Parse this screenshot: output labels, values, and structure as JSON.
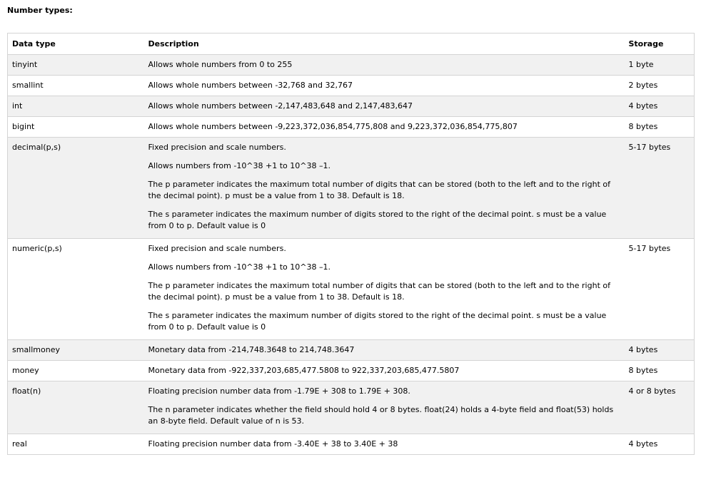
{
  "heading": "Number types:",
  "table": {
    "headers": [
      "Data type",
      "Description",
      "Storage"
    ],
    "rows": [
      {
        "type": "tinyint",
        "description": [
          "Allows whole numbers from 0 to 255"
        ],
        "storage": "1 byte"
      },
      {
        "type": "smallint",
        "description": [
          "Allows whole numbers between -32,768 and 32,767"
        ],
        "storage": "2 bytes"
      },
      {
        "type": "int",
        "description": [
          "Allows whole numbers between -2,147,483,648 and 2,147,483,647"
        ],
        "storage": "4 bytes"
      },
      {
        "type": "bigint",
        "description": [
          "Allows whole numbers between -9,223,372,036,854,775,808 and 9,223,372,036,854,775,807"
        ],
        "storage": "8 bytes"
      },
      {
        "type": "decimal(p,s)",
        "description": [
          "Fixed precision and scale numbers.",
          "Allows numbers from -10^38 +1 to 10^38 –1.",
          "The p parameter indicates the maximum total number of digits that can be stored (both to the left and to the right of the decimal point). p must be a value from 1 to 38. Default is 18.",
          "The s parameter indicates the maximum number of digits stored to the right of the decimal point. s must be a value from 0 to p. Default value is 0"
        ],
        "storage": "5-17 bytes"
      },
      {
        "type": "numeric(p,s)",
        "description": [
          "Fixed precision and scale numbers.",
          "Allows numbers from -10^38 +1 to 10^38 –1.",
          "The p parameter indicates the maximum total number of digits that can be stored (both to the left and to the right of the decimal point). p must be a value from 1 to 38. Default is 18.",
          "The s parameter indicates the maximum number of digits stored to the right of the decimal point. s must be a value from 0 to p. Default value is 0"
        ],
        "storage": "5-17 bytes"
      },
      {
        "type": "smallmoney",
        "description": [
          "Monetary data from -214,748.3648 to 214,748.3647"
        ],
        "storage": "4 bytes"
      },
      {
        "type": "money",
        "description": [
          "Monetary data from -922,337,203,685,477.5808 to 922,337,203,685,477.5807"
        ],
        "storage": "8 bytes"
      },
      {
        "type": "float(n)",
        "description": [
          "Floating precision number data from -1.79E + 308 to 1.79E + 308.",
          "The n parameter indicates whether the field should hold 4 or 8 bytes. float(24) holds a 4-byte field and float(53) holds an 8-byte field. Default value of n is 53."
        ],
        "storage": "4 or 8 bytes"
      },
      {
        "type": "real",
        "description": [
          "Floating precision number data from -3.40E + 38 to 3.40E + 38"
        ],
        "storage": "4 bytes"
      }
    ]
  }
}
